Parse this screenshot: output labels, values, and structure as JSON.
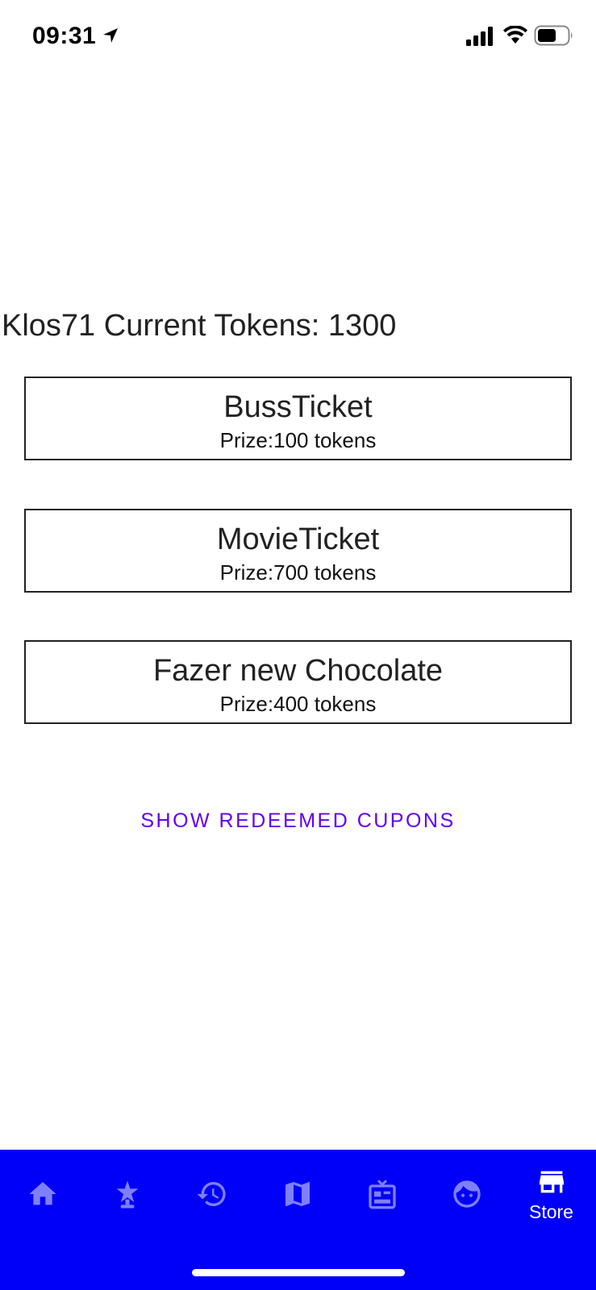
{
  "status_bar": {
    "time": "09:31",
    "icons": [
      "location-arrow-icon",
      "cellular-signal-icon",
      "wifi-icon",
      "battery-icon"
    ]
  },
  "store": {
    "heading": "Klos71 Current Tokens: 1300",
    "coupons": [
      {
        "title": "BussTicket",
        "price": "Prize:100 tokens"
      },
      {
        "title": "MovieTicket",
        "price": "Prize:700 tokens"
      },
      {
        "title": "Fazer new Chocolate",
        "price": "Prize:400 tokens"
      }
    ],
    "show_redeemed_label": "SHOW REDEEMED CUPONS"
  },
  "bottom_nav": {
    "items": [
      {
        "icon": "home-icon",
        "label": ""
      },
      {
        "icon": "award-icon",
        "label": ""
      },
      {
        "icon": "history-icon",
        "label": ""
      },
      {
        "icon": "map-icon",
        "label": ""
      },
      {
        "icon": "news-icon",
        "label": ""
      },
      {
        "icon": "face-icon",
        "label": ""
      },
      {
        "icon": "store-icon",
        "label": "Store"
      }
    ],
    "active_item": "Store"
  },
  "colors": {
    "nav_background": "#0000fa",
    "nav_icon_inactive": "#7f7ffd",
    "nav_active": "#ffffff",
    "link": "#6200ee",
    "card_border": "#222222"
  }
}
